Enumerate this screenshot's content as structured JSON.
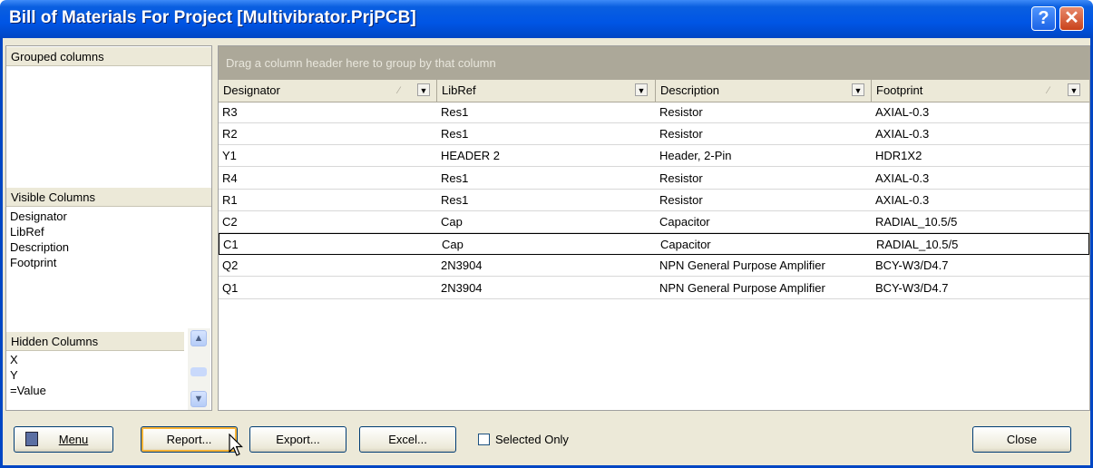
{
  "window": {
    "title": "Bill of Materials For Project [Multivibrator.PrjPCB]",
    "help_icon": "?",
    "close_icon": "✕"
  },
  "left_panel": {
    "grouped_columns_header": "Grouped columns",
    "visible_columns_header": "Visible Columns",
    "visible_columns": [
      "Designator",
      "LibRef",
      "Description",
      "Footprint"
    ],
    "hidden_columns_header": "Hidden Columns",
    "hidden_columns": [
      "X",
      "Y",
      "=Value"
    ]
  },
  "grid": {
    "group_hint": "Drag a column header here to group by that column",
    "columns": [
      "Designator",
      "LibRef",
      "Description",
      "Footprint"
    ],
    "rows": [
      [
        "R3",
        "Res1",
        "Resistor",
        "AXIAL-0.3"
      ],
      [
        "R2",
        "Res1",
        "Resistor",
        "AXIAL-0.3"
      ],
      [
        "Y1",
        "HEADER 2",
        "Header, 2-Pin",
        "HDR1X2"
      ],
      [
        "R4",
        "Res1",
        "Resistor",
        "AXIAL-0.3"
      ],
      [
        "R1",
        "Res1",
        "Resistor",
        "AXIAL-0.3"
      ],
      [
        "C2",
        "Cap",
        "Capacitor",
        "RADIAL_10.5/5"
      ],
      [
        "C1",
        "Cap",
        "Capacitor",
        "RADIAL_10.5/5"
      ],
      [
        "Q2",
        "2N3904",
        "NPN General Purpose Amplifier",
        "BCY-W3/D4.7"
      ],
      [
        "Q1",
        "2N3904",
        "NPN General Purpose Amplifier",
        "BCY-W3/D4.7"
      ]
    ],
    "focused_row": 6
  },
  "footer": {
    "menu_label": "Menu",
    "report_label": "Report...",
    "export_label": "Export...",
    "excel_label": "Excel...",
    "selected_only_label": "Selected Only",
    "close_label": "Close"
  }
}
